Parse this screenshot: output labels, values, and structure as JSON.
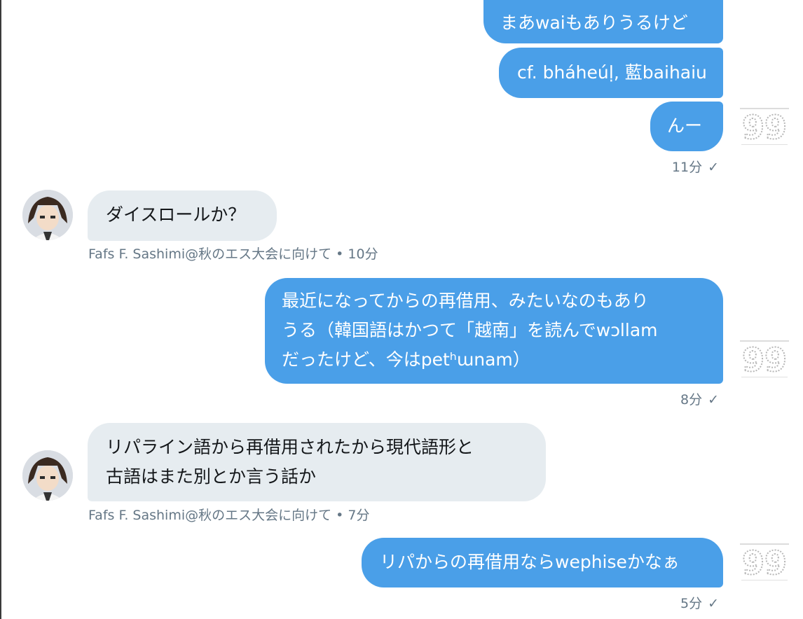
{
  "conversation": {
    "messages": [
      {
        "lines": [
          "まあwaiもありうるけど"
        ]
      },
      {
        "lines": [
          "cf. bháheúḷ, 藍baihaiu"
        ]
      },
      {
        "lines": [
          "んー"
        ]
      },
      {
        "time": "11分"
      },
      {
        "lines": [
          "ダイスロールか？"
        ]
      },
      {
        "sender": "Fafs F. Sashimi@秋のエス大会に向けて",
        "time": "10分"
      },
      {
        "lines": [
          "最近になってからの再借用、みたいなのもあり",
          "うる（韓国語はかつて「越南」を読んでwɔllam",
          "だったけど、今はpetʰɯnam）"
        ]
      },
      {
        "time": "8分"
      },
      {
        "lines": [
          "リパライン語から再借用されたから現代語形と",
          "古語はまた別とか言う話か"
        ]
      },
      {
        "sender": "Fafs F. Sashimi@秋のエス大会に向けて",
        "time": "7分"
      },
      {
        "lines": [
          "リパからの再借用ならwephiseかなぁ"
        ]
      },
      {
        "time": "5分"
      }
    ],
    "meta_separator": " • ",
    "read_mark": "✓",
    "read_avatar_text": "99"
  },
  "colors": {
    "outgoing_bubble": "#4a9fe8",
    "incoming_bubble": "#e6ecf0",
    "meta_text": "#657786"
  }
}
